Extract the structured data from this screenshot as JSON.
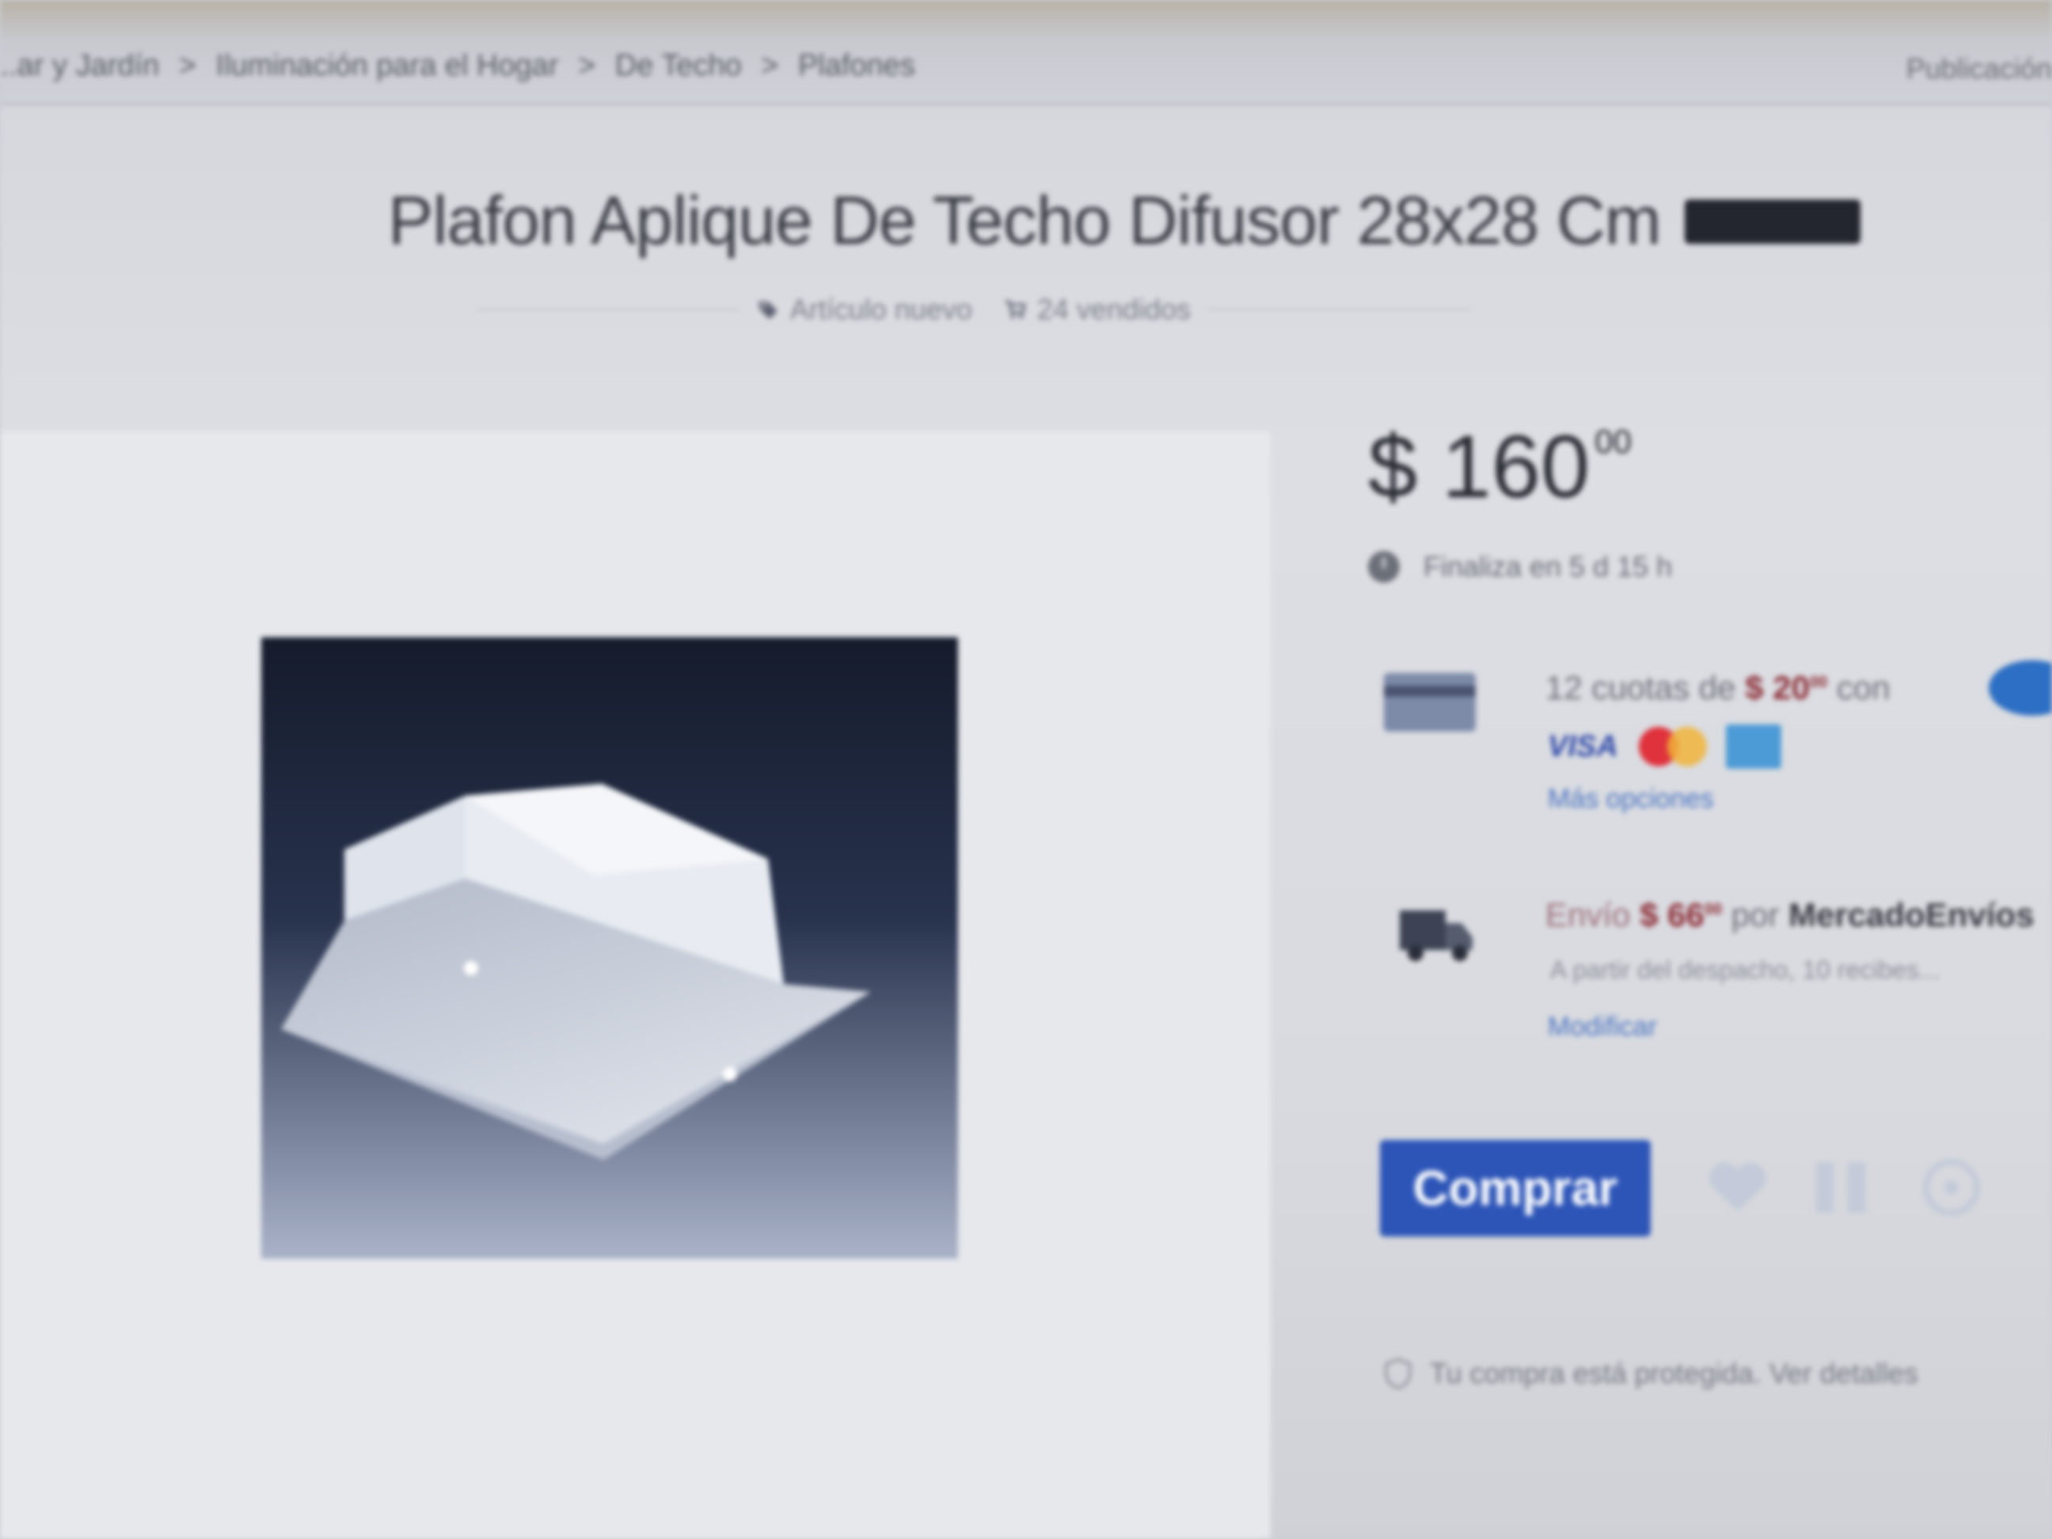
{
  "breadcrumb": {
    "items": [
      "...ar y Jardín",
      "Iluminación para el Hogar",
      "De Techo",
      "Plafones"
    ],
    "separator": ">"
  },
  "header": {
    "right_link": "Publicación..."
  },
  "product": {
    "title": "Plafon Aplique De Techo Difusor 28x28 Cm",
    "badge": "",
    "condition": "Artículo nuevo",
    "sold": "24 vendidos",
    "image_alt": "square glass ceiling light fixture on dark blue background"
  },
  "price": {
    "currency": "$",
    "amount": "160",
    "cents": "00"
  },
  "ends_in": "Finaliza en 5 d 15 h",
  "payment": {
    "installments_prefix": "12 cuotas de",
    "installment_amount": "$ 20",
    "installment_cents": "00",
    "installments_suffix": "con",
    "visa_label": "VISA",
    "more_options": "Más opciones"
  },
  "shipping": {
    "label": "Envío",
    "amount": "$ 66",
    "cents": "00",
    "by": "por",
    "carrier": "MercadoEnvíos",
    "detail": "A partir del despacho, 10 recibes...",
    "modify": "Modificar"
  },
  "actions": {
    "buy": "Comprar"
  },
  "protection": {
    "text": "Tu compra está protegida. Ver detalles"
  },
  "colors": {
    "buy_button": "#2d55b8",
    "price_red": "#8c2b35",
    "link_blue": "#4a73c2",
    "image_background": "#1b2235"
  },
  "icons": [
    "tag-icon",
    "cart-icon",
    "clock-icon",
    "credit-card-icon",
    "mercadopago-logo",
    "truck-icon",
    "heart-icon",
    "share-icon",
    "question-icon",
    "shield-icon"
  ]
}
